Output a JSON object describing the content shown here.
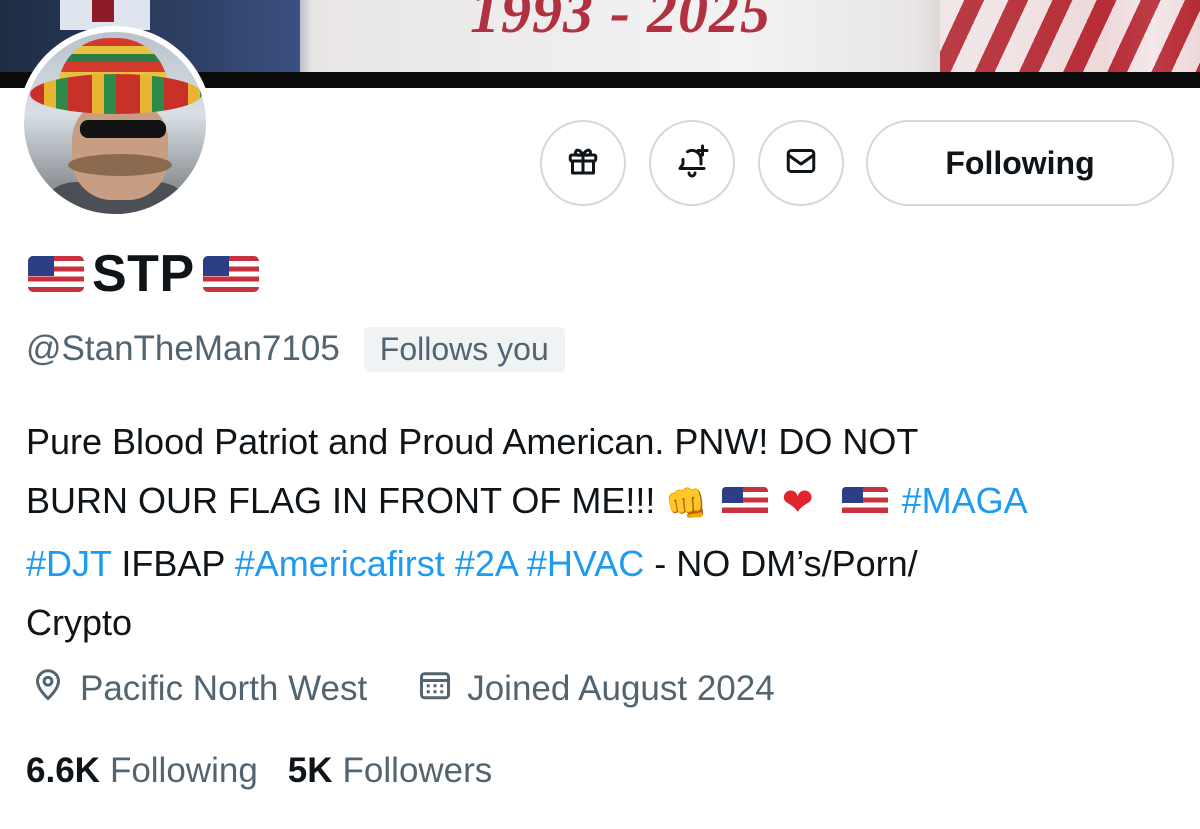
{
  "banner": {
    "years_text": "1993 - 2025"
  },
  "profile": {
    "display_name": "STP",
    "handle": "@StanTheMan7105",
    "follows_you_badge": "Follows you",
    "bio": {
      "line1": "Pure Blood Patriot and Proud American. PNW! DO NOT",
      "line2_text": "BURN OUR FLAG IN FRONT OF ME!!!",
      "line2_fist": "👊",
      "line2_heart": "❤",
      "tag_maga": "#MAGA",
      "tag_djt": "#DJT",
      "text_ifbap": " IFBAP ",
      "tag_americafirst": "#Americafirst",
      "tag_2a": "#2A",
      "tag_hvac": "#HVAC",
      "text_tail": " - NO DM’s/Porn/",
      "line4": "Crypto"
    },
    "location": "Pacific North West",
    "joined": "Joined August 2024",
    "following_count": "6.6K",
    "following_label": "Following",
    "followers_count": "5K",
    "followers_label": "Followers"
  },
  "actions": {
    "gift_icon": "gift-icon",
    "notify_icon": "bell-plus-icon",
    "message_icon": "envelope-icon",
    "follow_button_label": "Following"
  },
  "colors": {
    "link": "#1d9bf0",
    "secondary_text": "#536471",
    "primary_text": "#0f1419",
    "border": "#cfd9de"
  }
}
